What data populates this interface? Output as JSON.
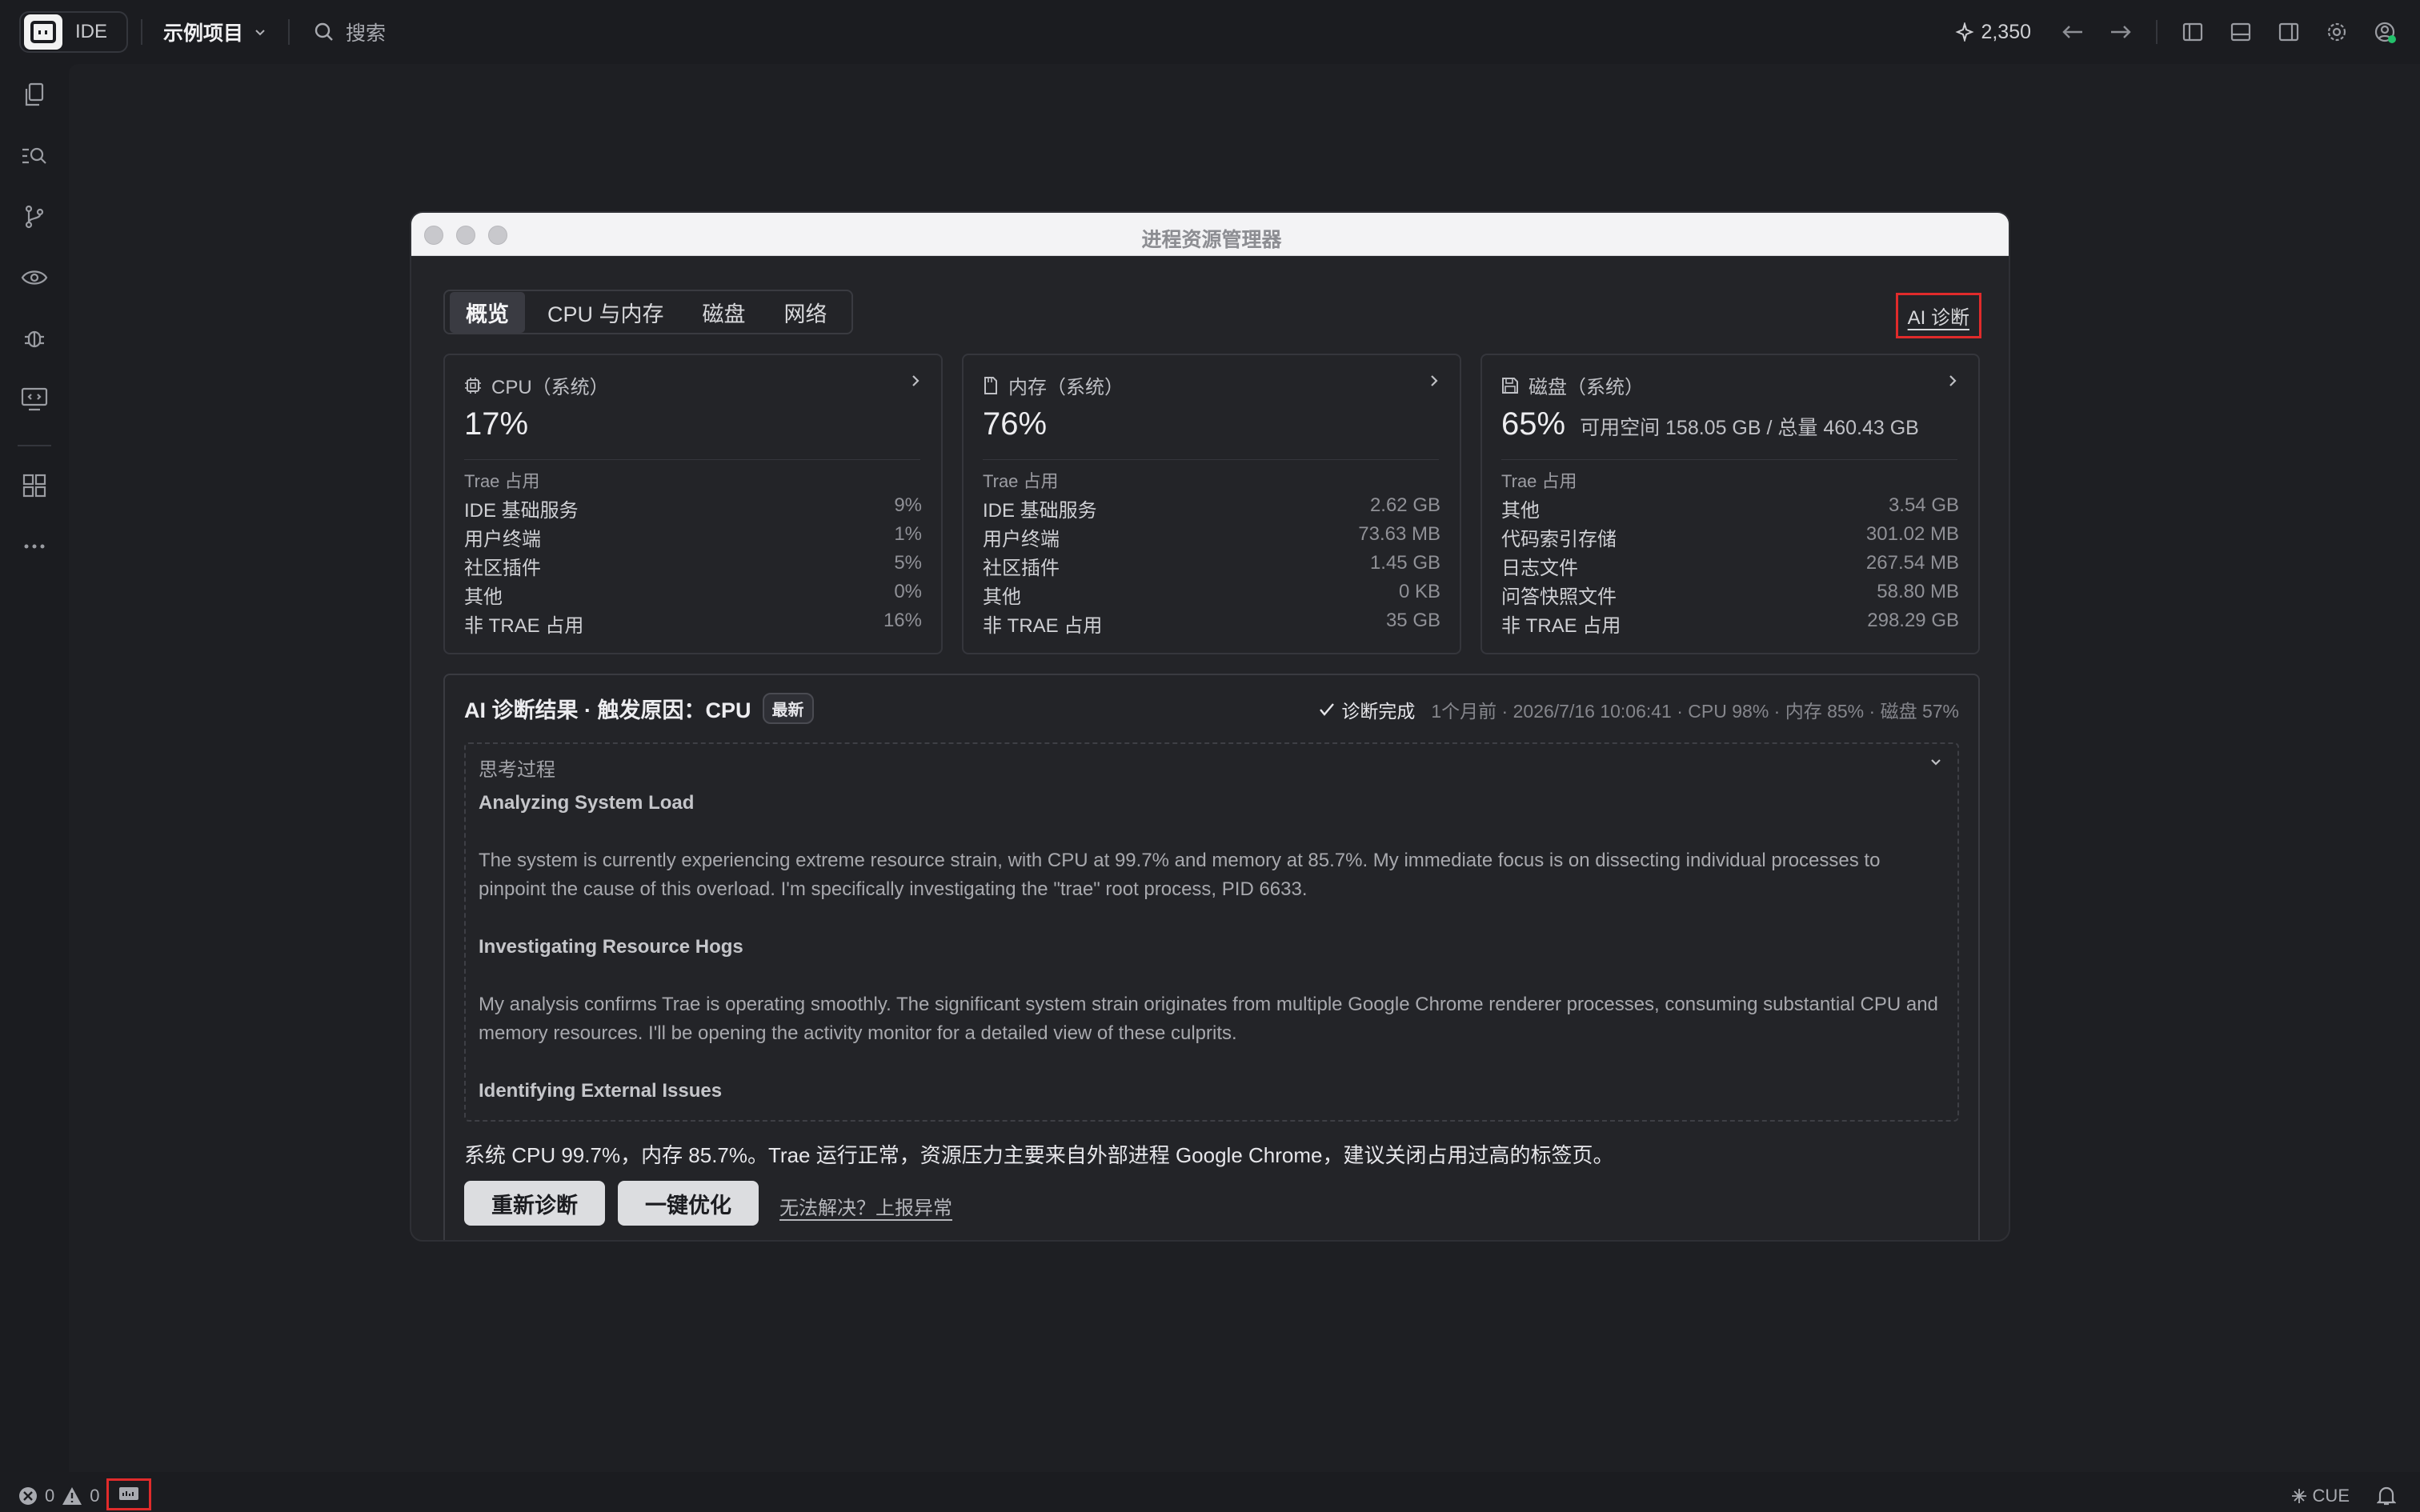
{
  "topbar": {
    "ide_label": "IDE",
    "project_name": "示例项目",
    "search_placeholder": "搜索",
    "credits": "2,350"
  },
  "modal": {
    "title": "进程资源管理器",
    "tabs": [
      "概览",
      "CPU 与内存",
      "磁盘",
      "网络"
    ],
    "active_tab": "概览",
    "ai_diagnose_label": "AI 诊断",
    "cards": [
      {
        "title": "CPU（系统）",
        "value": "17%",
        "sub": "",
        "section": "Trae 占用",
        "rows": [
          {
            "label": "IDE 基础服务",
            "value": "9%"
          },
          {
            "label": "用户终端",
            "value": "1%"
          },
          {
            "label": "社区插件",
            "value": "5%"
          },
          {
            "label": "其他",
            "value": "0%"
          },
          {
            "label": "非 TRAE 占用",
            "value": "16%"
          }
        ]
      },
      {
        "title": "内存（系统）",
        "value": "76%",
        "sub": "",
        "section": "Trae 占用",
        "rows": [
          {
            "label": "IDE 基础服务",
            "value": "2.62 GB"
          },
          {
            "label": "用户终端",
            "value": "73.63 MB"
          },
          {
            "label": "社区插件",
            "value": "1.45 GB"
          },
          {
            "label": "其他",
            "value": "0 KB"
          },
          {
            "label": "非 TRAE 占用",
            "value": "35 GB"
          }
        ]
      },
      {
        "title": "磁盘（系统）",
        "value": "65%",
        "sub": "可用空间 158.05 GB / 总量 460.43 GB",
        "section": "Trae 占用",
        "rows": [
          {
            "label": "其他",
            "value": "3.54 GB"
          },
          {
            "label": "代码索引存储",
            "value": "301.02 MB"
          },
          {
            "label": "日志文件",
            "value": "267.54 MB"
          },
          {
            "label": "问答快照文件",
            "value": "58.80 MB"
          },
          {
            "label": "非 TRAE 占用",
            "value": "298.29 GB"
          }
        ]
      }
    ],
    "diagnosis": {
      "title": "AI 诊断结果 · 触发原因：CPU",
      "badge": "最新",
      "status": "诊断完成",
      "meta": "1个月前 · 2026/7/16 10:06:41 · CPU 98% · 内存 85% · 磁盘 57%",
      "thinking_label": "思考过程",
      "thinking": [
        {
          "heading": "Analyzing System Load",
          "text": "The system is currently experiencing extreme resource strain, with CPU at 99.7% and memory at 85.7%. My immediate focus is on dissecting individual processes to pinpoint the cause of this overload. I'm specifically investigating the \"trae\" root process, PID 6633."
        },
        {
          "heading": "Investigating Resource Hogs",
          "text": "My analysis confirms Trae is operating smoothly. The significant system strain originates from multiple Google Chrome renderer processes, consuming substantial CPU and memory resources. I'll be opening the activity monitor for a detailed view of these culprits."
        },
        {
          "heading": "Identifying External Issues",
          "text": ""
        }
      ],
      "summary": "系统 CPU 99.7%，内存 85.7%。Trae 运行正常，资源压力主要来自外部进程 Google Chrome，建议关闭占用过高的标签页。",
      "rediagnose_label": "重新诊断",
      "optimize_label": "一键优化",
      "report_label": "无法解决？上报异常"
    }
  },
  "statusbar": {
    "errors": "0",
    "warnings": "0",
    "cue_label": "CUE"
  },
  "colors": {
    "background": "#1b1c20",
    "panel": "#232428",
    "highlight_box": "#e02b2b",
    "status_dot": "#23c16b"
  }
}
